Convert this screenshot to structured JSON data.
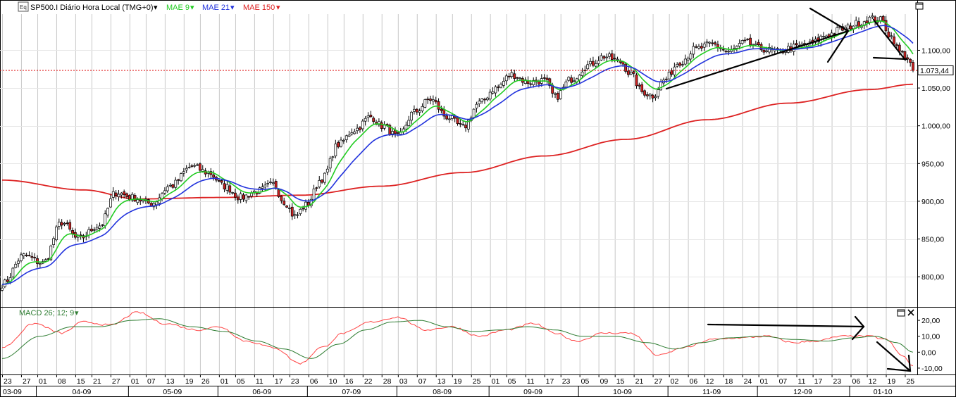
{
  "header": {
    "symbol_icon": "chart-symbol-icon",
    "title": "SP500.I Diário Hora Local (TMG+0)",
    "indicators": [
      {
        "label": "MAE 9",
        "color": "#22cc22"
      },
      {
        "label": "MAE 21",
        "color": "#2233dd"
      },
      {
        "label": "MAE 150",
        "color": "#dd2222"
      }
    ]
  },
  "macd": {
    "label": "MACD 26; 12; 9",
    "signal_color": "#2e7d32",
    "macd_color": "#ff4444"
  },
  "price_label": "1.073,44",
  "colors": {
    "up": "#ffffff",
    "down": "#cc2222",
    "wick": "#000000",
    "ref_line": "#dd0000"
  },
  "chart_data": [
    {
      "type": "candlestick",
      "title": "SP500.I Diário Hora Local (TMG+0)",
      "ylim": [
        760,
        1148
      ],
      "y_ticks": [
        "1.100,00",
        "1.050,00",
        "1.000,00",
        "950,00",
        "900,00",
        "850,00",
        "800,00"
      ],
      "y_tick_values": [
        1100,
        1050,
        1000,
        950,
        900,
        850,
        800
      ],
      "current_price": 1073.44,
      "day_ticks": [
        "23",
        "27",
        "01",
        "08",
        "15",
        "21",
        "27",
        "01",
        "07",
        "13",
        "19",
        "26",
        "01",
        "05",
        "11",
        "17",
        "23",
        "06",
        "10",
        "16",
        "22",
        "28",
        "03",
        "07",
        "13",
        "19",
        "25",
        "01",
        "05",
        "11",
        "17",
        "23",
        "05",
        "09",
        "15",
        "21",
        "27",
        "02",
        "06",
        "12",
        "18",
        "24",
        "01",
        "07",
        "11",
        "17",
        "23",
        "06",
        "12",
        "19",
        "25"
      ],
      "month_labels": [
        "03-09",
        "04-09",
        "05-09",
        "06-09",
        "07-09",
        "08-09",
        "09-09",
        "10-09",
        "11-09",
        "12-09",
        "01-10"
      ],
      "close_anchors": [
        [
          0,
          790
        ],
        [
          8,
          828
        ],
        [
          15,
          818
        ],
        [
          22,
          872
        ],
        [
          28,
          850
        ],
        [
          36,
          868
        ],
        [
          42,
          912
        ],
        [
          48,
          905
        ],
        [
          55,
          897
        ],
        [
          62,
          920
        ],
        [
          70,
          946
        ],
        [
          76,
          938
        ],
        [
          82,
          920
        ],
        [
          88,
          905
        ],
        [
          94,
          913
        ],
        [
          100,
          922
        ],
        [
          104,
          900
        ],
        [
          108,
          880
        ],
        [
          112,
          895
        ],
        [
          118,
          930
        ],
        [
          124,
          975
        ],
        [
          130,
          995
        ],
        [
          136,
          1012
        ],
        [
          140,
          1000
        ],
        [
          146,
          985
        ],
        [
          152,
          1018
        ],
        [
          158,
          1035
        ],
        [
          164,
          1012
        ],
        [
          170,
          998
        ],
        [
          176,
          1030
        ],
        [
          182,
          1050
        ],
        [
          188,
          1068
        ],
        [
          194,
          1058
        ],
        [
          200,
          1060
        ],
        [
          204,
          1038
        ],
        [
          210,
          1062
        ],
        [
          216,
          1080
        ],
        [
          222,
          1092
        ],
        [
          228,
          1085
        ],
        [
          232,
          1068
        ],
        [
          236,
          1045
        ],
        [
          240,
          1040
        ],
        [
          244,
          1060
        ],
        [
          250,
          1085
        ],
        [
          256,
          1102
        ],
        [
          262,
          1108
        ],
        [
          268,
          1098
        ],
        [
          274,
          1110
        ],
        [
          280,
          1102
        ],
        [
          286,
          1098
        ],
        [
          292,
          1104
        ],
        [
          298,
          1108
        ],
        [
          304,
          1120
        ],
        [
          310,
          1128
        ],
        [
          316,
          1136
        ],
        [
          320,
          1142
        ],
        [
          324,
          1140
        ],
        [
          328,
          1118
        ],
        [
          331,
          1098
        ],
        [
          334,
          1090
        ],
        [
          336,
          1073.44
        ]
      ],
      "ma_series": [
        {
          "name": "MAE 9",
          "period": 9
        },
        {
          "name": "MAE 21",
          "period": 21
        },
        {
          "name": "MAE 150",
          "period": 150,
          "anchors": [
            [
              0,
              928
            ],
            [
              30,
              915
            ],
            [
              50,
              903
            ],
            [
              80,
              905
            ],
            [
              110,
              908
            ],
            [
              140,
              920
            ],
            [
              170,
              938
            ],
            [
              200,
              960
            ],
            [
              230,
              982
            ],
            [
              260,
              1008
            ],
            [
              290,
              1030
            ],
            [
              320,
              1048
            ],
            [
              336,
              1055
            ]
          ]
        }
      ]
    },
    {
      "type": "line",
      "title": "MACD 26; 12; 9",
      "ylim": [
        -14,
        28
      ],
      "y_ticks": [
        "20,00",
        "10,00",
        "0,00",
        "-10,00"
      ],
      "y_tick_values": [
        20,
        10,
        0,
        -10
      ],
      "macd_anchors": [
        [
          0,
          3
        ],
        [
          12,
          18
        ],
        [
          22,
          12
        ],
        [
          30,
          19
        ],
        [
          40,
          17
        ],
        [
          50,
          25
        ],
        [
          60,
          18
        ],
        [
          72,
          14
        ],
        [
          80,
          16
        ],
        [
          90,
          7
        ],
        [
          100,
          3
        ],
        [
          110,
          -7
        ],
        [
          118,
          3
        ],
        [
          126,
          12
        ],
        [
          136,
          19
        ],
        [
          146,
          22
        ],
        [
          156,
          14
        ],
        [
          166,
          16
        ],
        [
          176,
          10
        ],
        [
          186,
          14
        ],
        [
          196,
          18
        ],
        [
          204,
          12
        ],
        [
          212,
          7
        ],
        [
          222,
          12
        ],
        [
          232,
          12
        ],
        [
          242,
          -2
        ],
        [
          252,
          3
        ],
        [
          262,
          8
        ],
        [
          272,
          9
        ],
        [
          282,
          10
        ],
        [
          292,
          6
        ],
        [
          300,
          7
        ],
        [
          310,
          10
        ],
        [
          320,
          10
        ],
        [
          326,
          8
        ],
        [
          332,
          -2
        ],
        [
          336,
          -9
        ]
      ],
      "signal_anchors": [
        [
          0,
          -4
        ],
        [
          14,
          10
        ],
        [
          26,
          16
        ],
        [
          36,
          16
        ],
        [
          48,
          20
        ],
        [
          58,
          21
        ],
        [
          70,
          16
        ],
        [
          82,
          13
        ],
        [
          94,
          7
        ],
        [
          104,
          2
        ],
        [
          114,
          -4
        ],
        [
          124,
          5
        ],
        [
          134,
          14
        ],
        [
          144,
          19
        ],
        [
          154,
          20
        ],
        [
          164,
          16
        ],
        [
          174,
          13
        ],
        [
          184,
          14
        ],
        [
          194,
          16
        ],
        [
          204,
          14
        ],
        [
          214,
          10
        ],
        [
          226,
          10
        ],
        [
          238,
          6
        ],
        [
          248,
          2
        ],
        [
          258,
          6
        ],
        [
          268,
          9
        ],
        [
          280,
          10
        ],
        [
          292,
          8
        ],
        [
          304,
          7
        ],
        [
          314,
          9
        ],
        [
          322,
          10
        ],
        [
          330,
          6
        ],
        [
          336,
          0
        ]
      ]
    }
  ]
}
